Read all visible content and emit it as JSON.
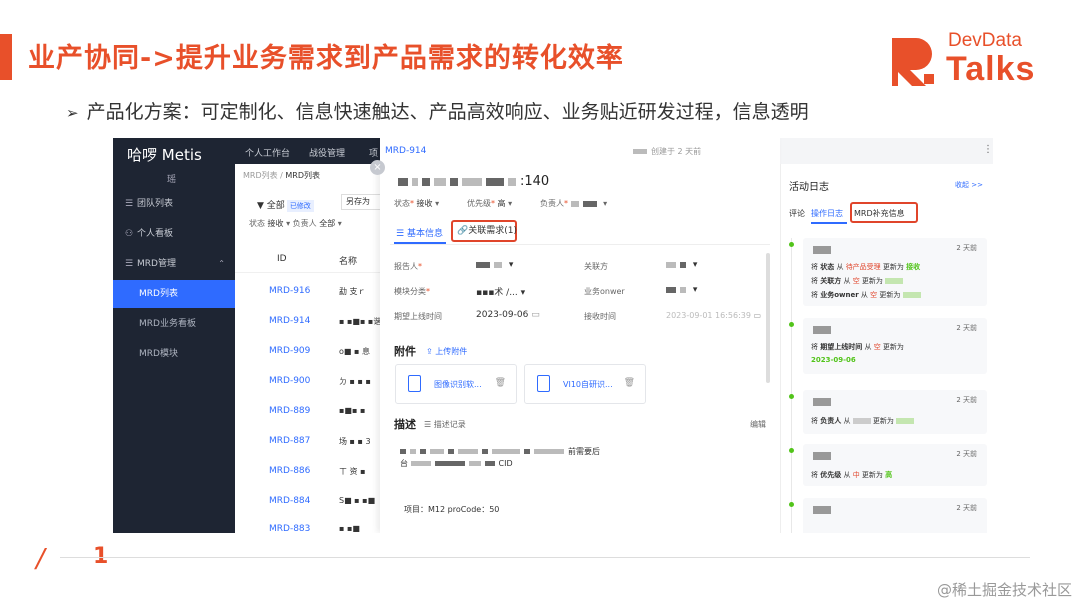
{
  "slide": {
    "title": "业产协同->提升业务需求到产品需求的转化效率",
    "subtitle": "产品化方案：可定制化、信息快速触达、产品高效响应、业务贴近研发过程，信息透明",
    "page_number": "1",
    "watermark": "@稀土掘金技术社区"
  },
  "logo": {
    "line1": "DevData",
    "line2": "Talks"
  },
  "sidebar": {
    "brand": "哈啰 Metis",
    "brand_sub": "瑶",
    "items": [
      {
        "icon": "☰",
        "label": "团队列表"
      },
      {
        "icon": "⚇",
        "label": "个人看板"
      },
      {
        "icon": "☰",
        "label": "MRD管理"
      },
      {
        "label": "MRD列表"
      },
      {
        "label": "MRD业务看板"
      },
      {
        "label": "MRD模块"
      }
    ]
  },
  "topnav": {
    "items": [
      "个人工作台",
      "战役管理",
      "项"
    ]
  },
  "list": {
    "breadcrumb_parent": "MRD列表",
    "breadcrumb_current": "MRD列表",
    "filter_all": "全部",
    "filter_modified": "已修改",
    "save_as": "另存为",
    "filter_status_label": "状态",
    "filter_status_value": "接收",
    "filter_owner_label": "负责人",
    "filter_owner_value": "全部",
    "col_id": "ID",
    "col_name": "名称",
    "rows": [
      {
        "id": "MRD-916",
        "name": "勐   支ｒ"
      },
      {
        "id": "MRD-914",
        "name": "▪ ▪■▪ ▪谐"
      },
      {
        "id": "MRD-909",
        "name": "o■ ▪ 息"
      },
      {
        "id": "MRD-900",
        "name": "   ㄉ ▪ ▪ ▪"
      },
      {
        "id": "MRD-889",
        "name": "▪■▪  ▪"
      },
      {
        "id": "MRD-887",
        "name": "  场 ▪ ▪ 3"
      },
      {
        "id": "MRD-886",
        "name": "  ㄒ   资 ▪"
      },
      {
        "id": "MRD-884",
        "name": "S■ ▪ ▪■"
      },
      {
        "id": "MRD-883",
        "name": "▪ ▪■"
      }
    ]
  },
  "detail": {
    "id": "MRD-914",
    "title_suffix": ":140",
    "status_label": "状态",
    "status_value": "接收",
    "priority_label": "优先级",
    "priority_value": "高",
    "owner_label": "负责人",
    "tab_basic": "基本信息",
    "tab_related": "关联需求(1)",
    "reporter_label": "报告人",
    "related_party_label": "关联方",
    "module_label": "模块分类",
    "module_value": "▪▪▪术 /...",
    "biz_owner_label": "业务onwer",
    "expected_label": "期望上线时间",
    "expected_value": "2023-09-06",
    "receive_label": "接收时间",
    "receive_value": "2023-09-01 16:56:39",
    "attachments_title": "附件",
    "upload_label": "上传附件",
    "attachments": [
      {
        "name": "图像识别软..."
      },
      {
        "name": "VI10自研识..."
      }
    ],
    "desc_title": "描述",
    "desc_record": "描述记录",
    "edit": "编辑",
    "desc_line1_tail": "前需要后",
    "desc_line2_start": "台",
    "desc_line2_tail": "CID",
    "project_line": "项目：M12   proCode：50",
    "created": "创建于 2 天前",
    "more_icon": "⋮"
  },
  "activity": {
    "title": "活动日志",
    "collapse": "收起 >>",
    "tabs": [
      "评论",
      "操作日志",
      "MRD补充信息"
    ],
    "entries": [
      {
        "when": "2 天前",
        "lines": [
          {
            "pre": "将 ",
            "key": "状态",
            "mid": " 从 ",
            "from": "待产品受理",
            "to_text": " 更新为 ",
            "to": "接收"
          },
          {
            "pre": "将 ",
            "key": "关联方",
            "mid": " 从 ",
            "from": "空",
            "to_text": " 更新为 ",
            "to": ""
          },
          {
            "pre": "将 ",
            "key": "业务owner",
            "mid": " 从 ",
            "from": "空",
            "to_text": " 更新为 ",
            "to": ""
          }
        ]
      },
      {
        "when": "2 天前",
        "lines": [
          {
            "pre": "将 ",
            "key": "期望上线时间",
            "mid": " 从 ",
            "from": "空",
            "to_text": " 更新为",
            "to": ""
          },
          {
            "pre": "",
            "key": "",
            "mid": "",
            "from": "",
            "to_text": "",
            "to": "2023-09-06"
          }
        ]
      },
      {
        "when": "2 天前",
        "lines": [
          {
            "pre": "将 ",
            "key": "负责人",
            "mid": " 从 ",
            "from": "",
            "to_text": " 更新为 ",
            "to": ""
          }
        ]
      },
      {
        "when": "2 天前",
        "lines": [
          {
            "pre": "将 ",
            "key": "优先级",
            "mid": " 从 ",
            "from": "中",
            "to_text": " 更新为 ",
            "to": "高"
          }
        ]
      },
      {
        "when": "2 天前",
        "lines": []
      }
    ]
  },
  "colors": {
    "accent": "#e8502a",
    "link": "#2f6bff",
    "sidebar": "#1e2533",
    "highlight_box": "#e0452b"
  }
}
